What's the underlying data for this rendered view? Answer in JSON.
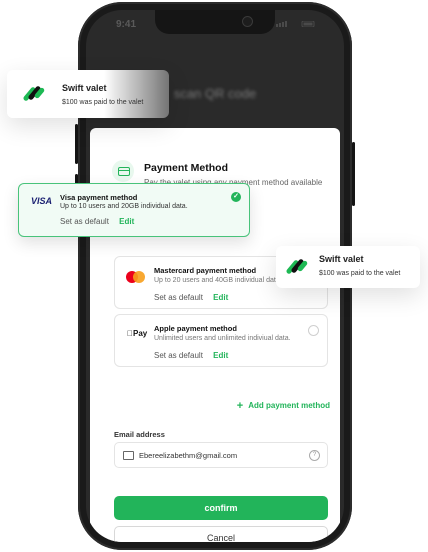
{
  "status_bar": {
    "time": "9:41"
  },
  "header": {
    "title": "scan QR code"
  },
  "payment": {
    "title": "Payment Method",
    "subtitle": "Pay the valet using any payment method available here."
  },
  "visa": {
    "brand": "VISA",
    "title": "Visa payment method",
    "desc": "Up to 10 users and 20GB individual data.",
    "set_default": "Set as default",
    "edit": "Edit"
  },
  "mastercard": {
    "title": "Mastercard payment method",
    "desc": "Up to 20 users and 40GB individual data.",
    "set_default": "Set as default",
    "edit": "Edit"
  },
  "apple": {
    "brand": "Pay",
    "title": "Apple payment method",
    "desc": "Unlimited users and unlimited indiviual data.",
    "set_default": "Set as default",
    "edit": "Edit"
  },
  "add_payment": "Add payment method",
  "email": {
    "label": "Email address",
    "value": "Ebereelizabethm@gmail.com"
  },
  "buttons": {
    "confirm": "confirm",
    "cancel": "Cancel"
  },
  "toast_top": {
    "title": "Swift valet",
    "message": "$100 was paid to the valet"
  },
  "toast_right": {
    "title": "Swift valet",
    "message": "$100 was paid to the valet"
  },
  "colors": {
    "accent": "#22b45a",
    "phone": "#1a1a1a"
  }
}
